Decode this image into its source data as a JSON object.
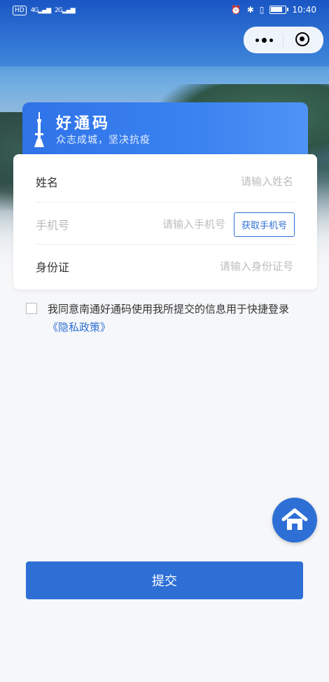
{
  "status_bar": {
    "left_badge": "HD",
    "signal_1": "4G",
    "signal_2": "2G",
    "time": "10:40",
    "battery_level": 0.85
  },
  "capsule": {
    "more_icon": "more-dots-icon",
    "close_icon": "target-close-icon"
  },
  "banner": {
    "title": "好通码",
    "subtitle": "众志成城，坚决抗疫",
    "icon": "tower-icon"
  },
  "form": {
    "name_label": "姓名",
    "name_placeholder": "请输入姓名",
    "phone_label": "手机号",
    "phone_placeholder": "请输入手机号",
    "get_phone_label": "获取手机号",
    "id_label": "身份证",
    "id_placeholder": "请输入身份证号"
  },
  "agreement": {
    "text": "我同意南通好通码使用我所提交的信息用于快捷登录",
    "policy_link": "《隐私政策》"
  },
  "home_icon": "home-icon",
  "submit_label": "提交",
  "colors": {
    "primary": "#2e6fd6",
    "banner_start": "#2f73e8",
    "banner_end": "#4f93f5",
    "background": "#f6f7f9"
  }
}
